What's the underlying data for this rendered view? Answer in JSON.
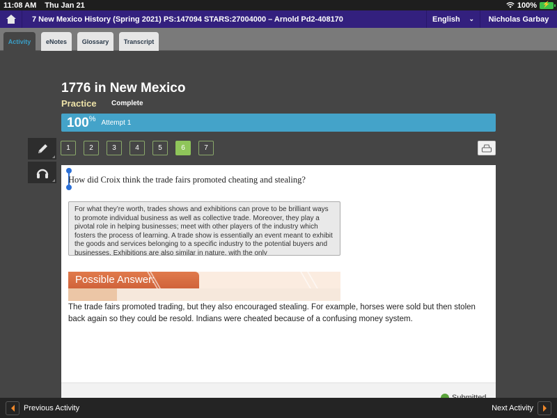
{
  "status_bar": {
    "time": "11:08 AM",
    "date": "Thu Jan 21",
    "battery": "100%",
    "wifi_icon": "wifi-icon",
    "battery_icon": "battery-charging-icon"
  },
  "header": {
    "home_icon": "home-icon",
    "course_title": "7 New Mexico History (Spring 2021) PS:147094 STARS:27004000 – Arnold Pd2-408170",
    "language": "English",
    "language_icon": "chevron-down-icon",
    "user_name": "Nicholas Garbay"
  },
  "tabs": [
    {
      "label": "Activity",
      "active": true
    },
    {
      "label": "eNotes",
      "active": false
    },
    {
      "label": "Glossary",
      "active": false
    },
    {
      "label": "Transcript",
      "active": false
    }
  ],
  "lesson": {
    "title": "1776 in New Mexico",
    "type": "Practice",
    "status": "Complete",
    "score": "100",
    "score_unit": "%",
    "attempt": "Attempt 1"
  },
  "tools": [
    {
      "icon": "pencil-icon"
    },
    {
      "icon": "headphones-icon"
    }
  ],
  "pages": {
    "items": [
      "1",
      "2",
      "3",
      "4",
      "5",
      "6",
      "7"
    ],
    "current": "6"
  },
  "print_icon": "print-icon",
  "question": {
    "prompt": "How did Croix think the trade fairs promoted cheating and stealing?",
    "passage": "For what they’re worth, trades shows and exhibitions can prove to be brilliant ways to promote individual business as well as collective trade. Moreover, they play a pivotal role in helping businesses; meet with other players of the industry which fosters the process of learning. A trade show is essentially an event meant to exhibit the goods and services belonging to a specific industry to the potential buyers and businesses. Exhibitions are also similar in nature, with the only",
    "answer_label": "Possible Answer:",
    "answer_text": "The trade fairs promoted trading, but they also encouraged stealing. For example, horses were sold but then stolen back again so they could be resold. Indians were cheated because of a confusing money system.",
    "submitted_label": "Submitted"
  },
  "footer": {
    "previous_label": "Previous Activity",
    "next_label": "Next Activity"
  },
  "colors": {
    "header_bg": "#33207e",
    "score_bar": "#44a3c9",
    "practice_label": "#ede2a8",
    "current_page": "#8fc55a",
    "answer_banner": "#d0633a",
    "nav_arrow": "#f0882a"
  }
}
